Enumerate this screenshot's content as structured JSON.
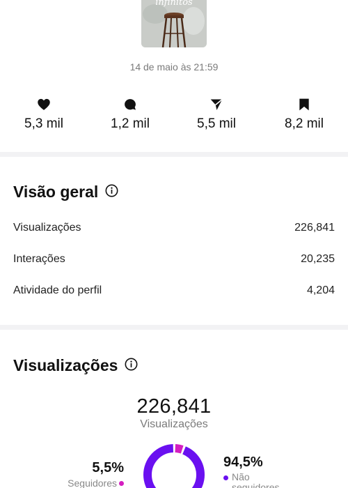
{
  "post": {
    "thumbnail_text": "infinitos",
    "date": "14 de maio às 21:59"
  },
  "stats": [
    {
      "icon": "heart-icon",
      "value": "5,3 mil"
    },
    {
      "icon": "comment-icon",
      "value": "1,2 mil"
    },
    {
      "icon": "share-icon",
      "value": "5,5 mil"
    },
    {
      "icon": "bookmark-icon",
      "value": "8,2 mil"
    }
  ],
  "overview": {
    "title": "Visão geral",
    "rows": [
      {
        "label": "Visualizações",
        "value": "226,841"
      },
      {
        "label": "Interações",
        "value": "20,235"
      },
      {
        "label": "Atividade do perfil",
        "value": "4,204"
      }
    ]
  },
  "views": {
    "title": "Visualizações",
    "total": "226,841",
    "total_label": "Visualizações",
    "followers": {
      "percent": "5,5%",
      "label": "Seguidores",
      "fraction": 0.055,
      "color": "#d41ec0"
    },
    "non_followers": {
      "percent": "94,5%",
      "label_line1": "Não",
      "label_line2": "seguidores",
      "fraction": 0.945,
      "color": "#6a10f0"
    }
  }
}
